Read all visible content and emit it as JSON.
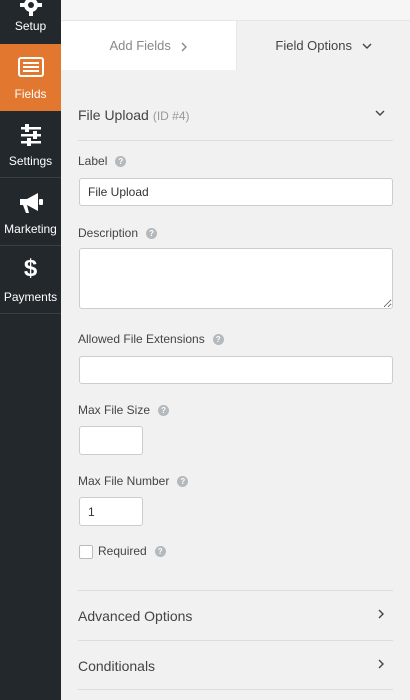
{
  "sidebar": {
    "items": [
      {
        "label": "Setup",
        "icon": "gear-icon"
      },
      {
        "label": "Fields",
        "icon": "fields-list-icon",
        "active": true
      },
      {
        "label": "Settings",
        "icon": "sliders-icon"
      },
      {
        "label": "Marketing",
        "icon": "megaphone-icon"
      },
      {
        "label": "Payments",
        "icon": "dollar-icon"
      }
    ],
    "active_color": "#e27730",
    "bg_color": "#23282d"
  },
  "tabs": {
    "add_fields": "Add Fields",
    "field_options": "Field Options"
  },
  "field": {
    "title": "File Upload",
    "id_tag": "(ID #4)"
  },
  "form": {
    "label_label": "Label",
    "label_value": "File Upload",
    "description_label": "Description",
    "description_value": "",
    "extensions_label": "Allowed File Extensions",
    "extensions_value": "",
    "max_size_label": "Max File Size",
    "max_size_value": "",
    "max_number_label": "Max File Number",
    "max_number_value": "1",
    "required_label": "Required",
    "required_checked": false,
    "help_glyph": "?"
  },
  "sections": {
    "advanced": "Advanced Options",
    "conditionals": "Conditionals"
  }
}
